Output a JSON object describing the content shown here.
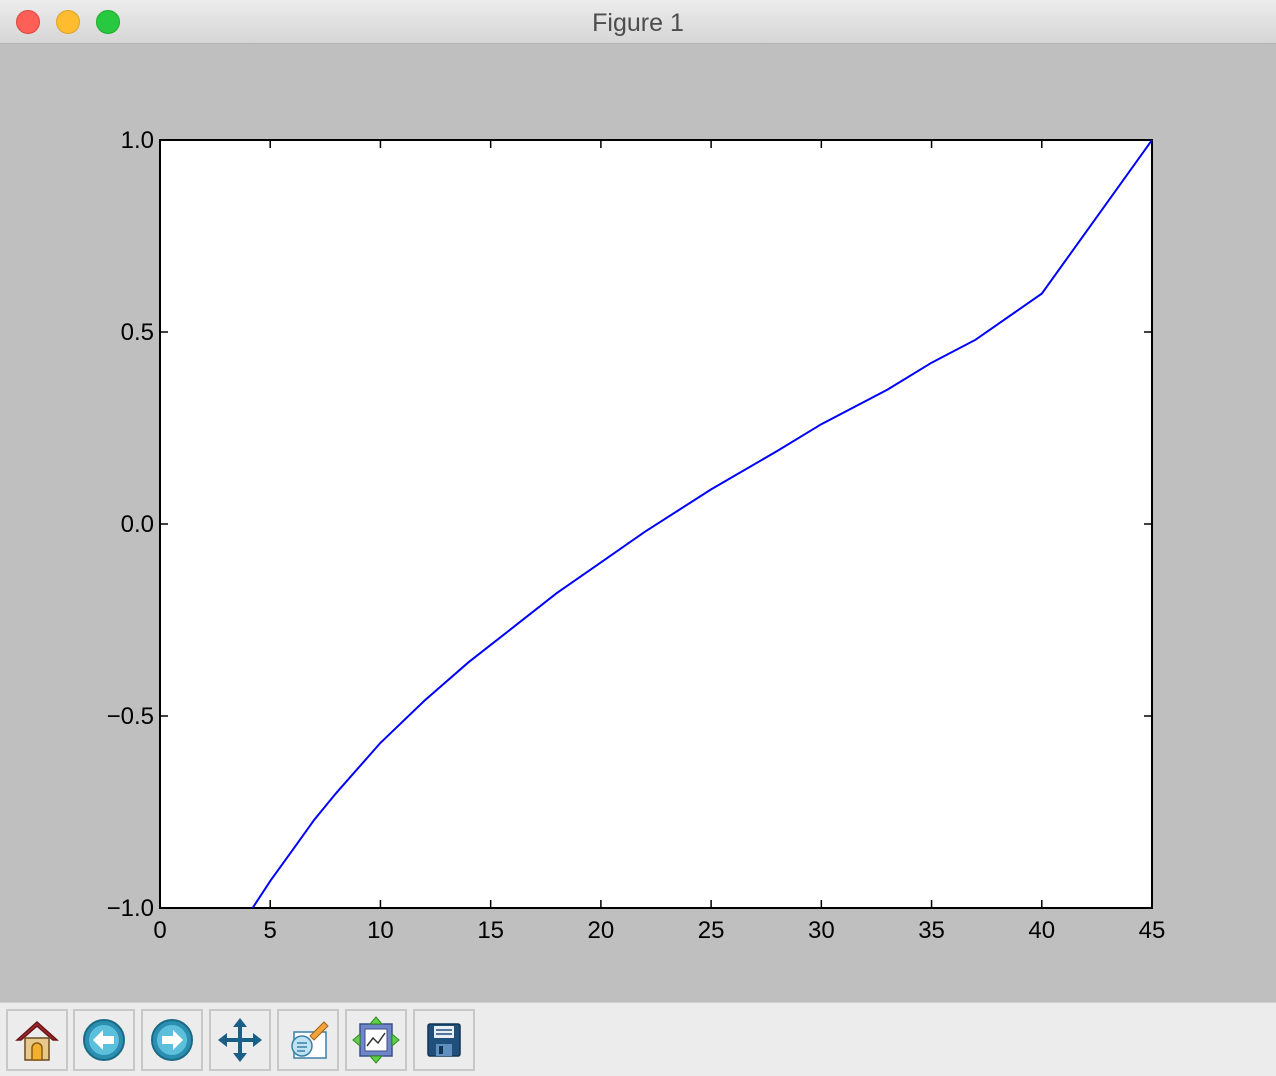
{
  "window": {
    "title": "Figure 1"
  },
  "toolbar": {
    "buttons": [
      {
        "name": "home",
        "icon": "home-icon"
      },
      {
        "name": "back",
        "icon": "back-arrow-icon"
      },
      {
        "name": "forward",
        "icon": "forward-arrow-icon"
      },
      {
        "name": "pan",
        "icon": "move-arrows-icon"
      },
      {
        "name": "zoom",
        "icon": "zoom-rect-icon"
      },
      {
        "name": "subplots",
        "icon": "subplots-icon"
      },
      {
        "name": "save",
        "icon": "floppy-disk-icon"
      }
    ]
  },
  "colors": {
    "line": "#0000ff",
    "figure_bg": "#bfbfbf",
    "axes_bg": "#ffffff"
  },
  "chart_data": {
    "type": "line",
    "title": "",
    "xlabel": "",
    "ylabel": "",
    "xlim": [
      0,
      45
    ],
    "ylim": [
      -1.0,
      1.0
    ],
    "xticks": [
      0,
      5,
      10,
      15,
      20,
      25,
      30,
      35,
      40,
      45
    ],
    "xtick_labels": [
      "0",
      "5",
      "10",
      "15",
      "20",
      "25",
      "30",
      "35",
      "40",
      "45"
    ],
    "yticks": [
      -1.0,
      -0.5,
      0.0,
      0.5,
      1.0
    ],
    "ytick_labels": [
      "−1.0",
      "−0.5",
      "0.0",
      "0.5",
      "1.0"
    ],
    "grid": false,
    "series": [
      {
        "x": [
          4.2,
          5,
          6,
          7,
          8,
          10,
          12,
          14,
          16,
          18,
          20,
          22,
          25,
          28,
          30,
          33,
          35,
          37,
          40,
          42,
          45
        ],
        "y": [
          -1.0,
          -0.93,
          -0.85,
          -0.77,
          -0.7,
          -0.57,
          -0.46,
          -0.36,
          -0.27,
          -0.18,
          -0.1,
          -0.02,
          0.09,
          0.19,
          0.26,
          0.35,
          0.42,
          0.48,
          0.6,
          0.76,
          1.0
        ]
      }
    ]
  }
}
